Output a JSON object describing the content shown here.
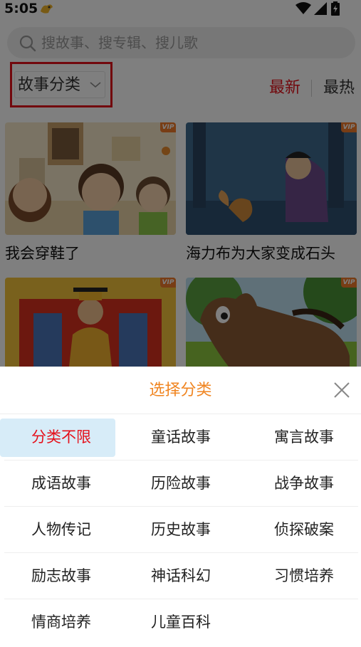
{
  "status_bar": {
    "time": "5:05",
    "icons": [
      "app-notification-icon",
      "wifi-icon",
      "signal-icon",
      "battery-icon"
    ]
  },
  "search": {
    "placeholder": "搜故事、搜专辑、搜儿歌"
  },
  "filter": {
    "category_label": "故事分类",
    "sort_newest": "最新",
    "sort_hottest": "最热",
    "active_sort": "最新",
    "highlight_color": "#e5101a"
  },
  "cards": [
    {
      "title": "我会穿鞋了",
      "badge": "VIP"
    },
    {
      "title": "海力布为大家变成石头",
      "badge": "VIP"
    },
    {
      "title": "",
      "badge": "VIP"
    },
    {
      "title": "",
      "badge": "VIP"
    }
  ],
  "sheet": {
    "title": "选择分类",
    "title_color": "#f08521",
    "selected": "分类不限",
    "rows": [
      [
        "分类不限",
        "童话故事",
        "寓言故事"
      ],
      [
        "成语故事",
        "历险故事",
        "战争故事"
      ],
      [
        "人物传记",
        "历史故事",
        "侦探破案"
      ],
      [
        "励志故事",
        "神话科幻",
        "习惯培养"
      ],
      [
        "情商培养",
        "儿童百科",
        ""
      ]
    ]
  }
}
